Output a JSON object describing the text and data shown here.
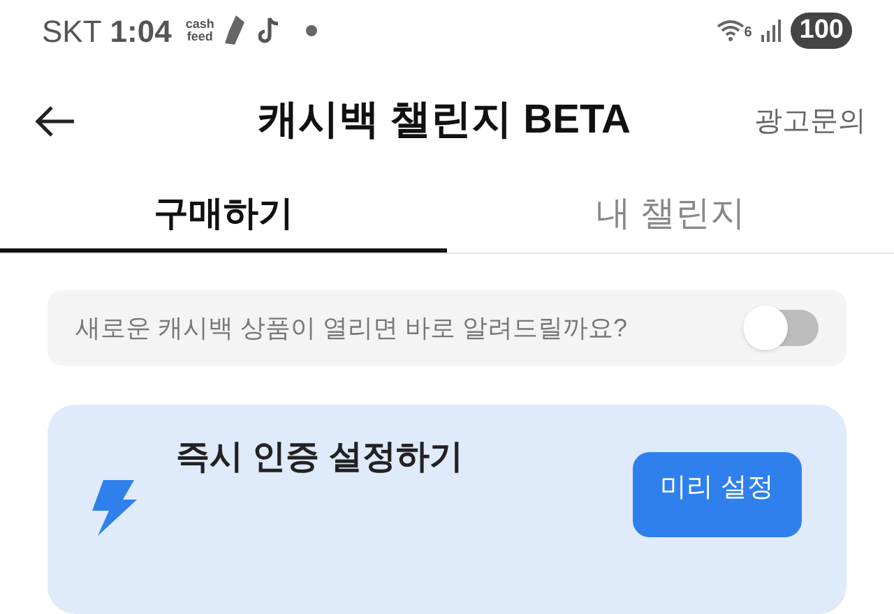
{
  "status_bar": {
    "carrier": "SKT",
    "time": "1:04",
    "app_logo": [
      "cash",
      "feed"
    ],
    "network_badge": "6",
    "battery": "100"
  },
  "header": {
    "title": "캐시백 챌린지 BETA",
    "action": "광고문의"
  },
  "tabs": [
    {
      "label": "구매하기",
      "selected": true
    },
    {
      "label": "내 챌린지",
      "selected": false
    }
  ],
  "notify": {
    "label": "새로운 캐시백 상품이 열리면 바로 알려드릴까요?",
    "on": false
  },
  "instant_card": {
    "title": "즉시 인증 설정하기",
    "button": "미리 설정"
  }
}
